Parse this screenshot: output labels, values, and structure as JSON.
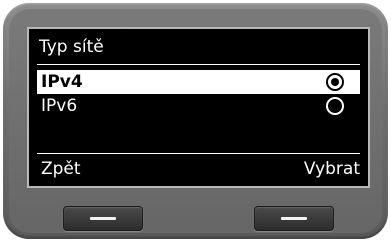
{
  "screen": {
    "title": "Typ sítě",
    "options": [
      {
        "label": "IPv4",
        "selected": true
      },
      {
        "label": "IPv6",
        "selected": false
      }
    ]
  },
  "softkeys": {
    "left_label": "Zpět",
    "right_label": "Vybrat"
  },
  "icons": {
    "radio_selected": "radio-selected-icon",
    "radio_unselected": "radio-unselected-icon",
    "hardware_key": "dash-icon"
  }
}
